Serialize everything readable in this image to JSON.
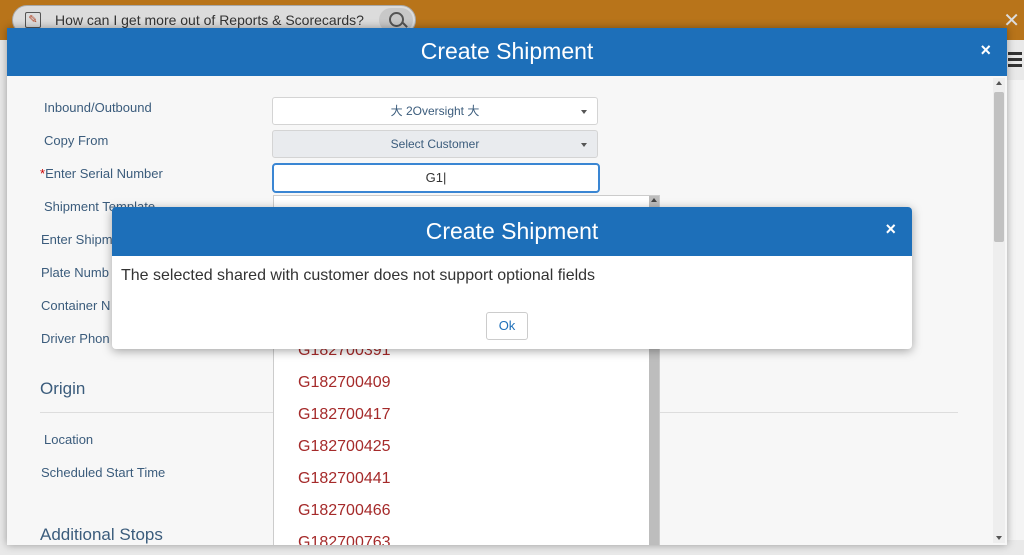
{
  "background": {
    "help_search_text": "How can I get more out of Reports & Scorecards?"
  },
  "modal": {
    "title": "Create Shipment",
    "close": "×",
    "labels": {
      "inbound_outbound": "Inbound/Outbound",
      "copy_from": "Copy From",
      "serial_required_mark": "*",
      "serial": "Enter Serial Number",
      "template": "Shipment Template",
      "shipment": "Enter Shipm",
      "plate": "Plate Numb",
      "container": "Container N",
      "driver": "Driver Phon",
      "location": "Location",
      "scheduled_start": "Scheduled Start Time"
    },
    "inbound_outbound_value": "大 2Oversight 大",
    "copy_from_value": "Select Customer",
    "serial_value": "G1|",
    "sections": {
      "origin": "Origin",
      "additional_stops": "Additional Stops"
    },
    "dropdown_items": [
      "G182700391",
      "G182700409",
      "G182700417",
      "G182700425",
      "G182700441",
      "G182700466",
      "G182700763"
    ]
  },
  "dialog": {
    "title": "Create Shipment",
    "close": "×",
    "message": "The selected shared with customer does not support optional fields",
    "ok": "Ok"
  }
}
